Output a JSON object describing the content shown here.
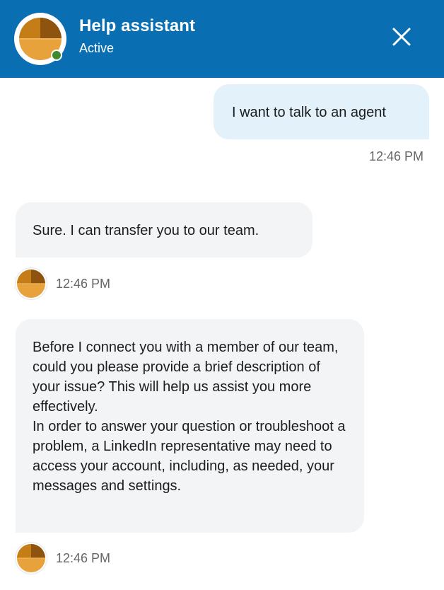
{
  "header": {
    "title": "Help assistant",
    "status": "Active",
    "close_icon": "close-icon",
    "accent_color": "#0a6fb2",
    "status_color": "#3f8a2e"
  },
  "messages": [
    {
      "sender": "user",
      "text": "I want to talk to an agent",
      "time": "12:46 PM"
    },
    {
      "sender": "assistant",
      "text": "Sure. I can transfer you to our team.",
      "time": "12:46 PM"
    },
    {
      "sender": "assistant",
      "paragraphs": [
        "Before I connect you with a member of our team, could you please provide a brief description of your issue? This will help us assist you more effectively.",
        "In order to answer your question or troubleshoot a problem, a LinkedIn representative may need to access your account, including, as needed, your messages and settings."
      ],
      "time": "12:46 PM"
    }
  ]
}
